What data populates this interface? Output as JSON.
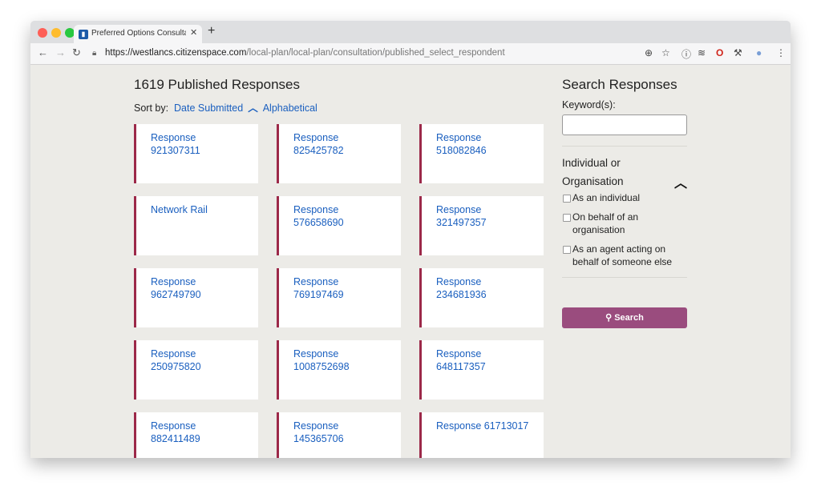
{
  "browser": {
    "tab_title": "Preferred Options Consultation",
    "url_host": "https://westlancs.citizenspace.com",
    "url_path": "/local-plan/local-plan/consultation/published_select_respondent"
  },
  "main": {
    "heading": "1619 Published Responses",
    "sort_label": "Sort by:",
    "sort_active": "Date Submitted",
    "sort_alt": "Alphabetical",
    "cards": [
      "Response 921307311",
      "Response 825425782",
      "Response 518082846",
      "Network Rail",
      "Response 576658690",
      "Response 321497357",
      "Response 962749790",
      "Response 769197469",
      "Response 234681936",
      "Response 250975820",
      "Response 1008752698",
      "Response 648117357",
      "Response 882411489",
      "Response 145365706",
      "Response 61713017"
    ]
  },
  "sidebar": {
    "title": "Search Responses",
    "keyword_label": "Keyword(s):",
    "keyword_value": "",
    "filter_title": "Individual or Organisation",
    "options": [
      "As an individual",
      "On behalf of an organisation",
      "As an agent acting on behalf of someone else"
    ],
    "search_button": "Search"
  },
  "colors": {
    "accent_border": "#9c2949",
    "link": "#1a5fbf",
    "button": "#9a4c7e"
  }
}
